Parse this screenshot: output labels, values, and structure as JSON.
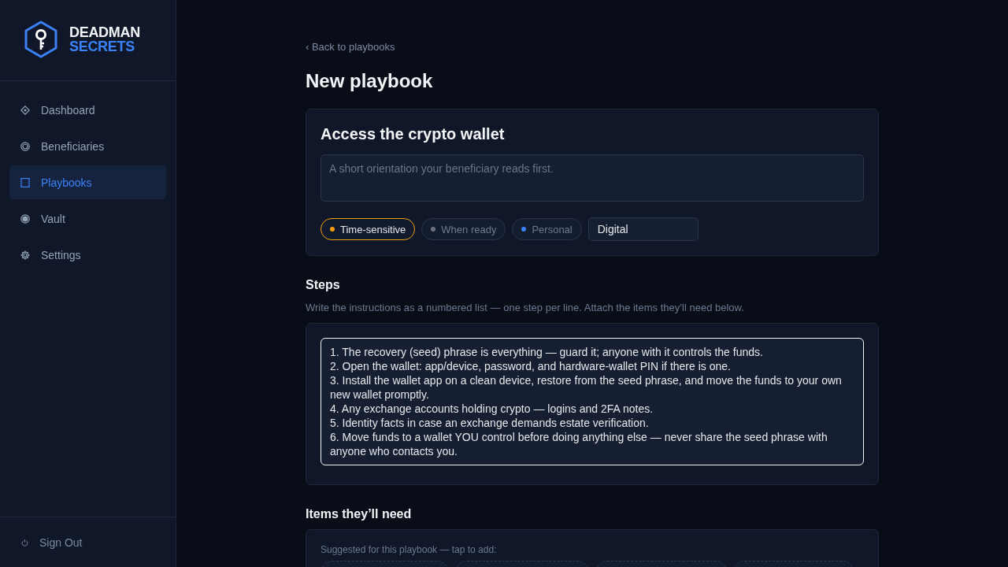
{
  "sidebar": {
    "logo": {
      "line_1": "DEADMAN",
      "line_2": "SECRETS"
    },
    "nav": [
      {
        "label": "Dashboard",
        "selected": false
      },
      {
        "label": "Beneficiaries",
        "selected": false
      },
      {
        "label": "Playbooks",
        "selected": true
      },
      {
        "label": "Vault",
        "selected": false
      },
      {
        "label": "Settings",
        "selected": false
      }
    ],
    "sign_out": "Sign Out"
  },
  "main": {
    "back_link": "‹ Back to playbooks",
    "title": "New playbook",
    "playbook": {
      "name": "Access the crypto wallet",
      "summary": {
        "placeholder": "A short orientation your beneficiary reads first."
      },
      "urgency": [
        {
          "label": "Time-sensitive",
          "color": "#f59e0b",
          "selected": true
        },
        {
          "label": "When ready",
          "color": "#6b7280",
          "selected": false
        },
        {
          "label": "Personal",
          "color": "#3b82f6",
          "selected": false
        }
      ],
      "category": {
        "value": "Digital"
      }
    },
    "steps": {
      "heading": "Steps",
      "hint": "Write the instructions as a numbered list — one step per line. Attach the items they’ll need below.",
      "value": "1. The recovery (seed) phrase is everything — guard it; anyone with it controls the funds.\n2. Open the wallet: app/device, password, and hardware-wallet PIN if there is one.\n3. Install the wallet app on a clean device, restore from the seed phrase, and move the funds to your own new wallet promptly.\n4. Any exchange accounts holding crypto — logins and 2FA notes.\n5. Identity facts in case an exchange demands estate verification.\n6. Move funds to a wallet YOU control before doing anything else — never share the seed phrase with anyone who contacts you."
    },
    "items": {
      "heading": "Items they’ll need",
      "hint": "Suggested for this playbook — tap to add:",
      "suggestions": [
        {
          "kind": "chip"
        },
        {
          "kind": "chip"
        },
        {
          "kind": "chip"
        },
        {
          "kind": "chip"
        }
      ]
    }
  }
}
